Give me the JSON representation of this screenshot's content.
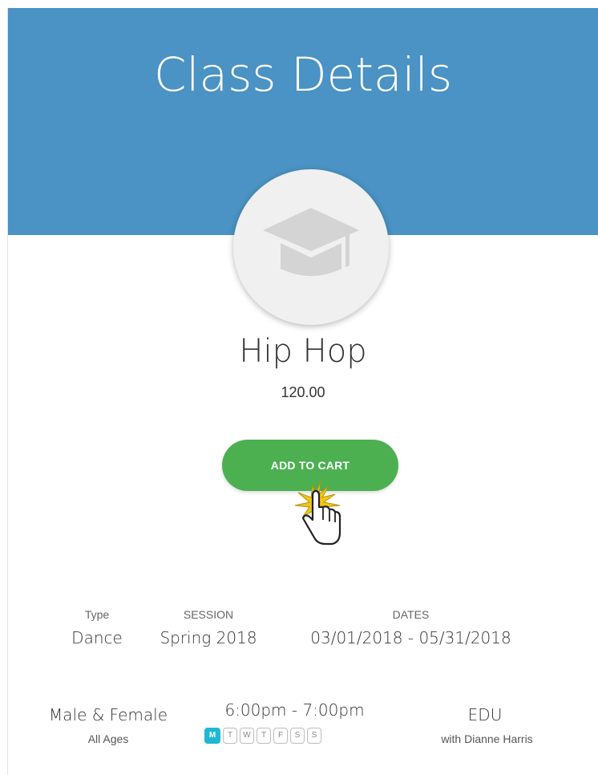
{
  "header": {
    "title": "Class Details",
    "band_color": "#4a93c4"
  },
  "class": {
    "avatar_icon": "graduation-cap-icon",
    "name": "Hip Hop",
    "price": "120.00"
  },
  "actions": {
    "add_to_cart_label": "ADD TO CART",
    "button_color": "#4cb050"
  },
  "details": {
    "type_label": "Type",
    "type_value": "Dance",
    "session_label": "SESSION",
    "session_value": "Spring 2018",
    "dates_label": "DATES",
    "dates_value": "03/01/2018 - 05/31/2018",
    "gender": "Male & Female",
    "ages": "All Ages",
    "time": "6:00pm - 7:00pm",
    "location": "EDU",
    "instructor": "with Dianne Harris"
  },
  "schedule": {
    "active_color": "#1fb7d4",
    "days": [
      {
        "label": "M",
        "active": true
      },
      {
        "label": "T",
        "active": false
      },
      {
        "label": "W",
        "active": false
      },
      {
        "label": "T",
        "active": false
      },
      {
        "label": "F",
        "active": false
      },
      {
        "label": "S",
        "active": false
      },
      {
        "label": "S",
        "active": false
      }
    ]
  }
}
